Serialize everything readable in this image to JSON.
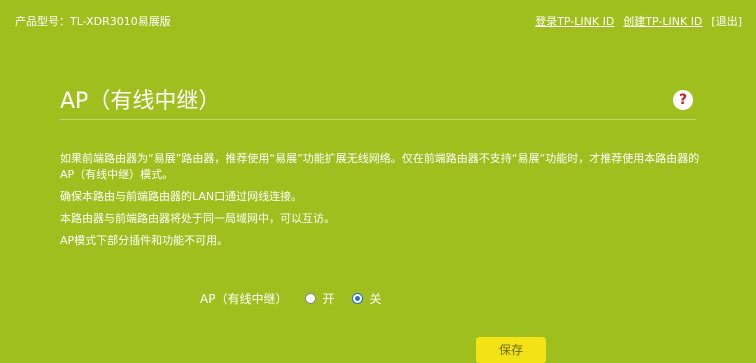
{
  "header": {
    "model": "产品型号：TL-XDR3010易展版",
    "login_link": "登录TP-LINK ID",
    "create_link": "创建TP-LINK ID",
    "logout": "[退出]"
  },
  "page": {
    "title": "AP（有线中继）",
    "help_icon": "?"
  },
  "description": [
    "如果前端路由器为“易展”路由器，推荐使用“易展”功能扩展无线网络。仅在前端路由器不支持“易展”功能时，才推荐使用本路由器的AP（有线中继）模式。",
    "确保本路由与前端路由器的LAN口通过网线连接。",
    "本路由器与前端路由器将处于同一局域网中，可以互访。",
    "AP模式下部分插件和功能不可用。"
  ],
  "form": {
    "label": "AP（有线中继）",
    "options": [
      {
        "label": "开",
        "checked": false
      },
      {
        "label": "关",
        "checked": true
      }
    ],
    "save_label": "保存"
  },
  "colors": {
    "background": "#9fbf1f",
    "button": "#f3e215",
    "help_icon": "#d2161e",
    "radio_selected": "#2b6fd6"
  }
}
